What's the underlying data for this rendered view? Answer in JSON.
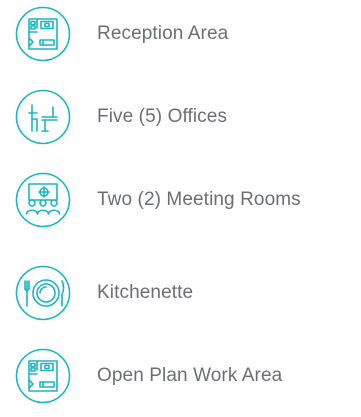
{
  "colors": {
    "accent": "#1DB4C4",
    "text": "#6C6F72",
    "background": "#FFFFFF"
  },
  "features": [
    {
      "label": "Reception Area",
      "icon": "floor-plan-icon"
    },
    {
      "label": "Five (5) Offices",
      "icon": "desk-chair-icon"
    },
    {
      "label": "Two (2) Meeting Rooms",
      "icon": "meeting-room-icon"
    },
    {
      "label": "Kitchenette",
      "icon": "plate-cutlery-icon"
    },
    {
      "label": "Open Plan Work Area",
      "icon": "floor-plan-icon"
    }
  ]
}
